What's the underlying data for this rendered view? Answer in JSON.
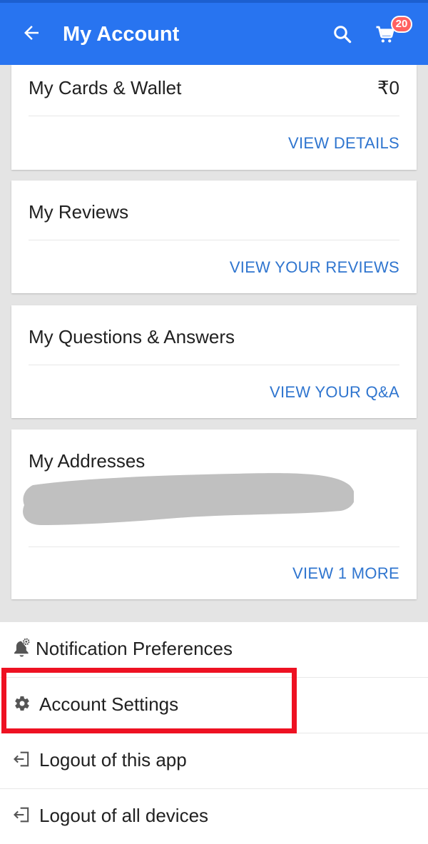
{
  "header": {
    "title": "My Account",
    "back_icon": "arrow-left-icon",
    "search_icon": "search-icon",
    "cart_icon": "cart-icon",
    "cart_count": "20"
  },
  "cards": {
    "wallet": {
      "title": "My Cards & Wallet",
      "value": "₹0",
      "link": "VIEW DETAILS"
    },
    "reviews": {
      "title": "My Reviews",
      "link": "VIEW YOUR REVIEWS"
    },
    "qa": {
      "title": "My Questions & Answers",
      "link": "VIEW YOUR Q&A"
    },
    "addresses": {
      "title": "My Addresses",
      "link": "VIEW 1 MORE"
    }
  },
  "menu": {
    "items": [
      {
        "label": "Notification Preferences",
        "icon": "bell-gear-icon"
      },
      {
        "label": "Account Settings",
        "icon": "gear-icon"
      },
      {
        "label": "Logout of this app",
        "icon": "logout-icon"
      },
      {
        "label": "Logout of all devices",
        "icon": "logout-icon"
      }
    ]
  },
  "colors": {
    "appbar": "#2874f0",
    "link": "#2f75cf",
    "highlight": "#ee1122",
    "badge": "#ff6161"
  }
}
